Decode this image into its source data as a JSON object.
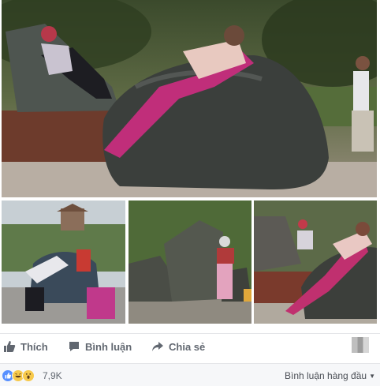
{
  "post": {
    "photos": [
      {
        "name": "main-photo",
        "subject": "people lying on large rocks in a park"
      },
      {
        "name": "thumb-1",
        "subject": "people leaning on a rock near a gate tower"
      },
      {
        "name": "thumb-2",
        "subject": "two big dark rocks with people"
      },
      {
        "name": "thumb-3",
        "subject": "woman stretching over a rock at sunset"
      }
    ]
  },
  "actions": {
    "like_label": "Thích",
    "comment_label": "Bình luận",
    "share_label": "Chia sẻ",
    "like_icon": "thumbs-up-icon",
    "comment_icon": "comment-bubble-icon",
    "share_icon": "share-arrow-icon"
  },
  "reactions": {
    "count": "7,9K",
    "icons": [
      "like-reaction-icon",
      "haha-reaction-icon",
      "wow-reaction-icon"
    ],
    "colors": {
      "like": "#5890ff",
      "haha": "#f7c94b",
      "wow": "#f7c94b"
    }
  },
  "comments": {
    "sort_label": "Bình luận hàng đầu"
  },
  "colors": {
    "text_muted": "#616770",
    "divider": "#e5e6e9",
    "bar_bg": "#f6f7f9"
  }
}
